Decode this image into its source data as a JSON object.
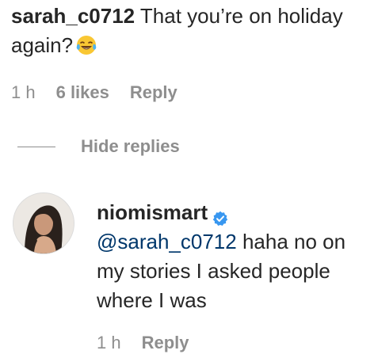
{
  "top_comment": {
    "username": "sarah_c0712",
    "text": "That you’re on holiday again?",
    "emoji": "laughing-tears-emoji",
    "time": "1 h",
    "likes": "6 likes",
    "reply_label": "Reply"
  },
  "replies_toggle": {
    "label": "Hide replies"
  },
  "reply": {
    "username": "niomismart",
    "verified_icon": "verified-badge-icon",
    "mention": "@sarah_c0712",
    "text": "haha no on my stories I asked people where I was",
    "time": "1 h",
    "reply_label": "Reply"
  },
  "colors": {
    "text": "#262626",
    "muted": "#8e8e8e",
    "mention": "#00376b",
    "verified": "#3897f0"
  }
}
